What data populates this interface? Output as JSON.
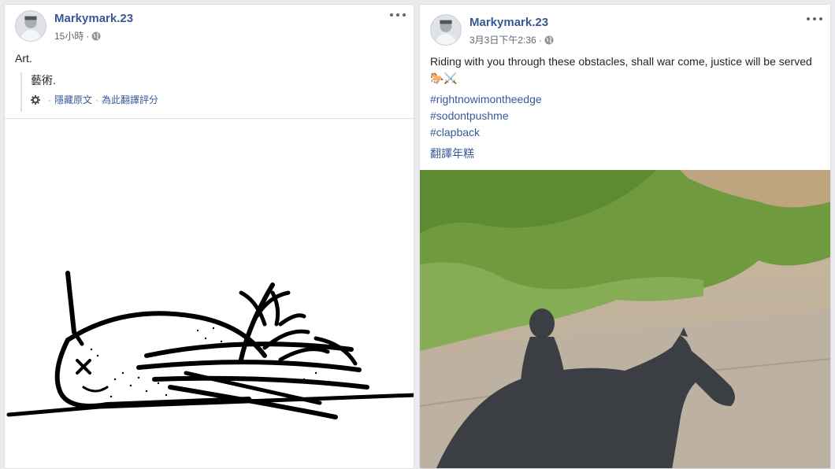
{
  "posts": [
    {
      "author": "Markymark.23",
      "time": "15小時",
      "separator": "·",
      "text": "Art.",
      "translation": {
        "text": "藝術.",
        "hide_original": "隱藏原文",
        "rate_translation": "為此翻譯評分"
      }
    },
    {
      "author": "Markymark.23",
      "time": "3月3日下午2:36",
      "separator": "·",
      "text": "Riding with you through these obstacles, shall war come, justice will be served 🐎⚔️",
      "hashtags": [
        "#rightnowimontheedge",
        "#sodontpushme",
        "#clapback"
      ],
      "see_translation": "翻譯年糕"
    }
  ],
  "icons": {
    "more": "more-options-icon",
    "privacy": "globe-icon",
    "settings": "gear-icon"
  },
  "colors": {
    "link": "#385898",
    "meta": "#616770",
    "background": "#e9ebee"
  }
}
